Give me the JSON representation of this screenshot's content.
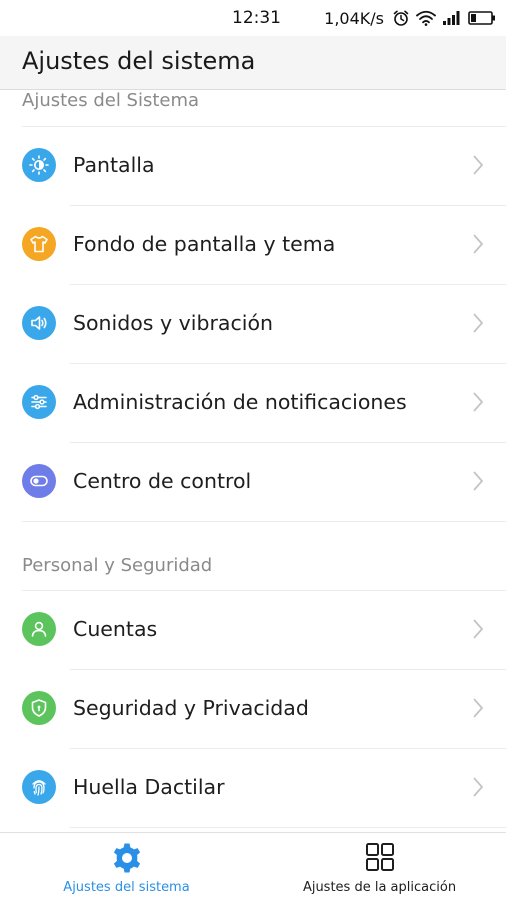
{
  "status_bar": {
    "time": "12:31",
    "speed": "1,04K/s",
    "icons": [
      "alarm-icon",
      "wifi-icon",
      "signal-icon",
      "battery-icon"
    ]
  },
  "header": {
    "title": "Ajustes del sistema"
  },
  "sections": [
    {
      "title": "Ajustes del Sistema",
      "items": [
        {
          "label": "Pantalla",
          "icon": "brightness-icon",
          "color": "#3aa7ea"
        },
        {
          "label": "Fondo de pantalla y tema",
          "icon": "tshirt-icon",
          "color": "#f5a623"
        },
        {
          "label": "Sonidos y vibración",
          "icon": "speaker-icon",
          "color": "#3aa7ea"
        },
        {
          "label": "Administración de notificaciones",
          "icon": "sliders-icon",
          "color": "#3aa7ea"
        },
        {
          "label": "Centro de control",
          "icon": "toggle-icon",
          "color": "#6e7de8"
        }
      ]
    },
    {
      "title": "Personal y Seguridad",
      "items": [
        {
          "label": "Cuentas",
          "icon": "person-icon",
          "color": "#5cc45c"
        },
        {
          "label": "Seguridad y Privacidad",
          "icon": "shield-icon",
          "color": "#5cc45c"
        },
        {
          "label": "Huella Dactilar",
          "icon": "fingerprint-icon",
          "color": "#3aa7ea"
        }
      ]
    }
  ],
  "bottom_nav": {
    "tabs": [
      {
        "label": "Ajustes del sistema",
        "icon": "gear-icon",
        "active": true,
        "color": "#2a8fe6"
      },
      {
        "label": "Ajustes de la aplicación",
        "icon": "grid-icon",
        "active": false,
        "color": "#1e1e1e"
      }
    ]
  }
}
